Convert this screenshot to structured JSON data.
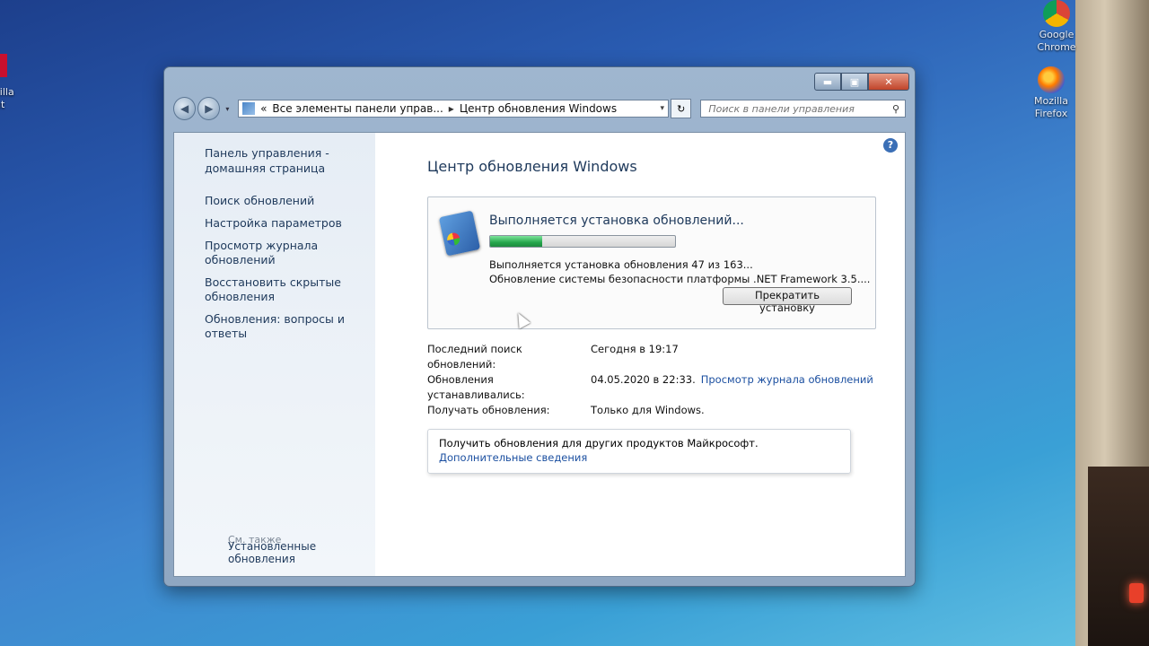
{
  "desktop": {
    "left_icon_label": "zilla\nnt",
    "icons": [
      {
        "name": "Google Chrome",
        "label_line1": "Google",
        "label_line2": "Chrome"
      },
      {
        "name": "Mozilla Firefox",
        "label_line1": "Mozilla",
        "label_line2": "Firefox"
      }
    ]
  },
  "window": {
    "caption_buttons": {
      "minimize": "▬",
      "maximize": "▣",
      "close": "✕"
    },
    "nav": {
      "back_icon": "◀",
      "forward_icon": "▶",
      "dropdown_icon": "▾"
    },
    "address": {
      "prefix": "«",
      "crumb1": "Все элементы панели управ...",
      "separator": "▸",
      "crumb2": "Центр обновления Windows",
      "dropdown": "▾",
      "refresh_icon": "↻"
    },
    "search": {
      "placeholder": "Поиск в панели управления",
      "icon": "⚲"
    }
  },
  "sidebar": {
    "home": "Панель управления - домашняя страница",
    "items": [
      {
        "label": "Поиск обновлений"
      },
      {
        "label": "Настройка параметров"
      },
      {
        "label": "Просмотр журнала обновлений"
      },
      {
        "label": "Восстановить скрытые обновления"
      },
      {
        "label": "Обновления: вопросы и ответы"
      }
    ],
    "see_also": "См. также",
    "installed_updates": "Установленные обновления"
  },
  "main": {
    "help_icon": "?",
    "title": "Центр обновления Windows",
    "status": {
      "heading": "Выполняется установка обновлений...",
      "progress_fraction": 0.28,
      "line1": "Выполняется установка обновления 47 из 163...",
      "line2": "Обновление системы безопасности платформы .NET Framework 3.5....",
      "stop_button": "Прекратить установку"
    },
    "info": {
      "last_search_label": "Последний поиск обновлений:",
      "last_search_value": "Сегодня в 19:17",
      "installed_label": "Обновления устанавливались:",
      "installed_value": "04.05.2020 в 22:33.",
      "history_link": "Просмотр журнала обновлений",
      "receive_label": "Получать обновления:",
      "receive_value": "Только для Windows."
    },
    "other": {
      "text": "Получить обновления для других продуктов Майкрософт.",
      "link": "Дополнительные сведения"
    }
  },
  "colors": {
    "progress": "#25a64c",
    "link": "#1b4fa0",
    "heading": "#1e395b"
  }
}
